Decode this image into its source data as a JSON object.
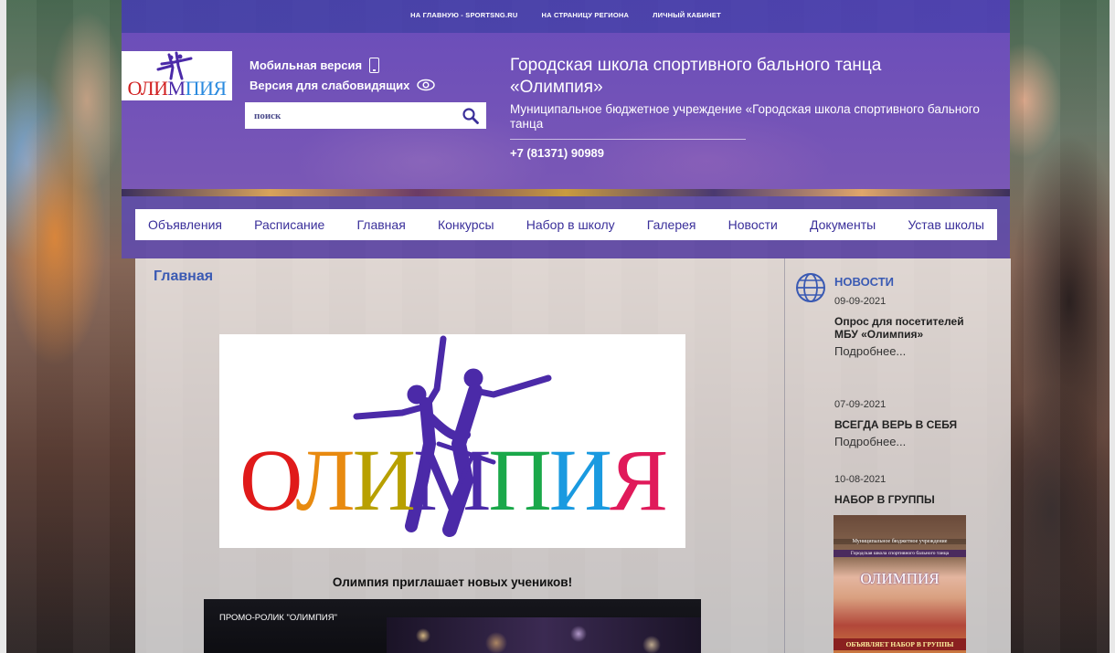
{
  "topbar": {
    "links": [
      "НА ГЛАВНУЮ - SPORTSNG.RU",
      "НА СТРАНИЦУ РЕГИОНА",
      "ЛИЧНЫЙ КАБИНЕТ"
    ]
  },
  "header": {
    "logo_text": "ОЛИМПИЯ",
    "mobile_label": "Мобильная версия",
    "accessible_label": "Версия для слабовидящих",
    "search_placeholder": "поиск",
    "title_line1": "Городская школа спортивного бального танца",
    "title_line2": "«Олимпия»",
    "subtitle": "Муниципальное бюджетное учреждение «Городская школа спортивного бального танца",
    "phone": "+7 (81371) 90989"
  },
  "nav": {
    "items": [
      "Объявления",
      "Расписание",
      "Главная",
      "Конкурсы",
      "Набор в школу",
      "Галерея",
      "Новости",
      "Документы",
      "Устав школы"
    ]
  },
  "main": {
    "page_title": "Главная",
    "logo_text": "ОЛИМПИЯ",
    "invite_text": "Олимпия приглашает новых учеников!",
    "video_title": "ПРОМО-РОЛИК \"ОЛИМПИЯ\""
  },
  "sidebar": {
    "heading": "НОВОСТИ",
    "news": [
      {
        "date": "09-09-2021",
        "title": "Опрос для посетителей МБУ «Олимпия»",
        "more": "Подробнее..."
      },
      {
        "date": "07-09-2021",
        "title": "ВСЕГДА ВЕРЬ В СЕБЯ",
        "more": "Подробнее..."
      },
      {
        "date": "10-08-2021",
        "title": "НАБОР В ГРУППЫ"
      }
    ],
    "thumb": {
      "caption_top": "Муниципальное бюджетное учреждение",
      "caption_mid": "Городская школа спортивного бального танца",
      "logo_text": "ОЛИМПИЯ",
      "caption_bottom": "ОБЪЯВЛЯЕТ НАБОР В ГРУППЫ"
    }
  },
  "colors": {
    "accent": "#3a5ab3",
    "nav_text": "#3a2f9a",
    "header_purple": "#5f46c8"
  }
}
